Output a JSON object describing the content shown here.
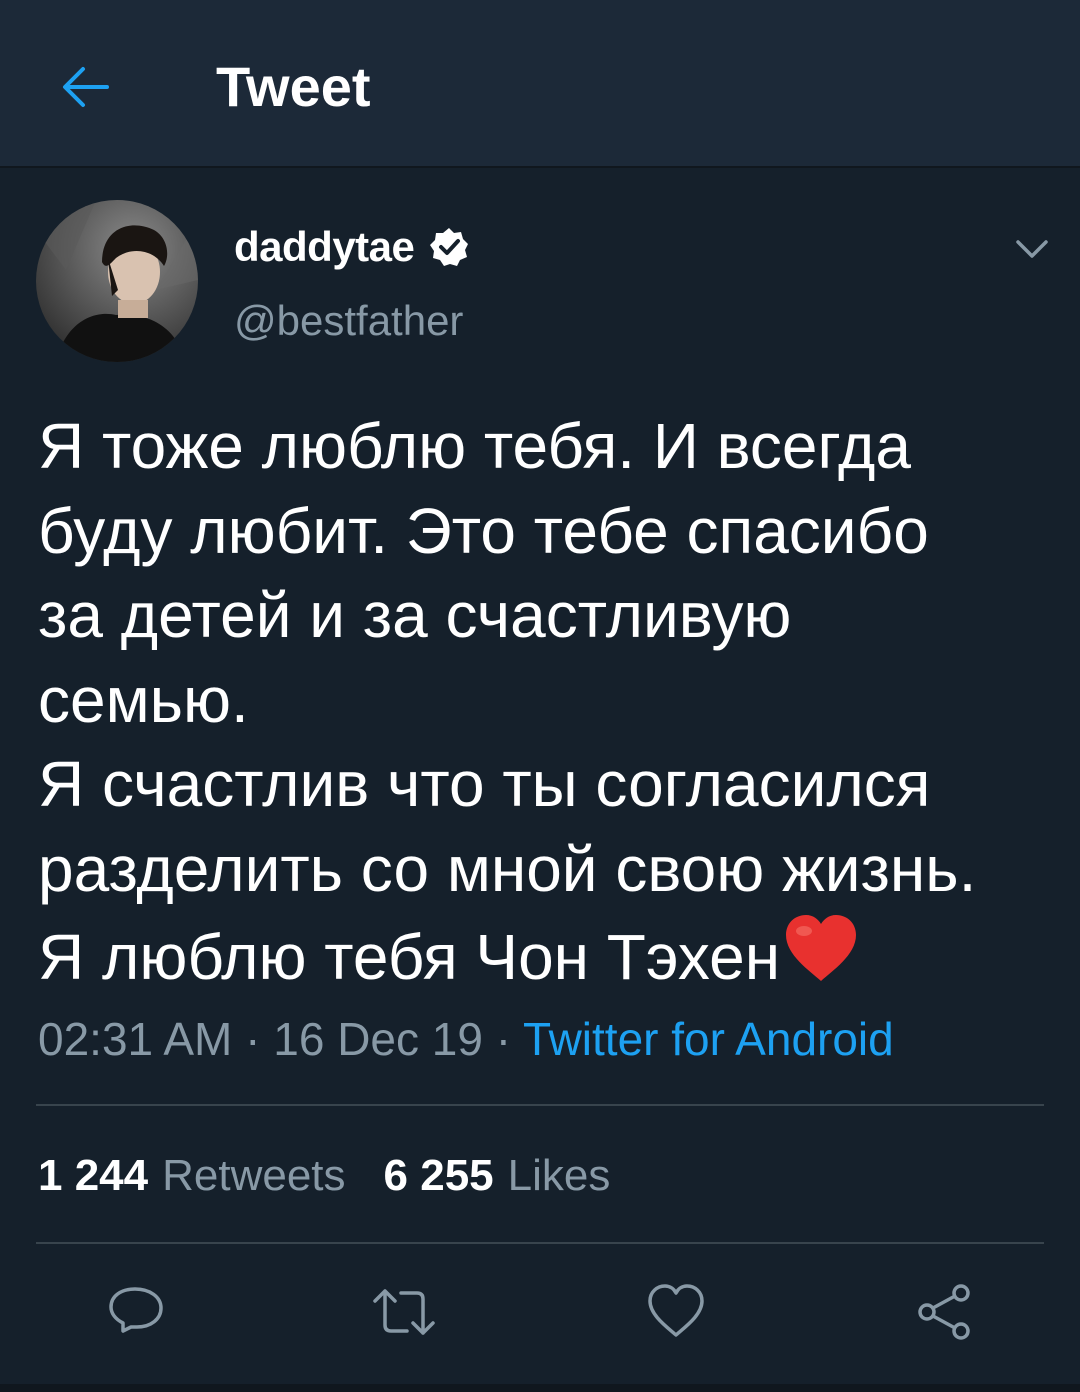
{
  "header": {
    "title": "Tweet",
    "back_icon": "arrow-left-icon"
  },
  "author": {
    "display_name": "daddytae",
    "handle": "@bestfather",
    "verified": true
  },
  "tweet": {
    "lines": [
      "Я тоже люблю тебя. И всегда",
      "буду любит. Это тебе спасибо",
      "за детей и за счастливую",
      "семью.",
      "Я счастлив что ты согласился",
      "разделить со мной свою жизнь.",
      "Я люблю тебя Чон Тэхен"
    ],
    "emoji": "red-heart-emoji"
  },
  "meta": {
    "time": "02:31 AM",
    "separator": " · ",
    "date": "16 Dec 19",
    "source": "Twitter for Android"
  },
  "stats": {
    "retweets_count": "1 244",
    "retweets_label": "Retweets",
    "likes_count": "6 255",
    "likes_label": "Likes"
  },
  "actions": [
    "reply-icon",
    "retweet-icon",
    "like-icon",
    "share-icon"
  ],
  "colors": {
    "background": "#15202b",
    "header_bg": "#1c2938",
    "accent": "#1da1f2",
    "muted": "#8899a6",
    "divider": "#38444d"
  }
}
